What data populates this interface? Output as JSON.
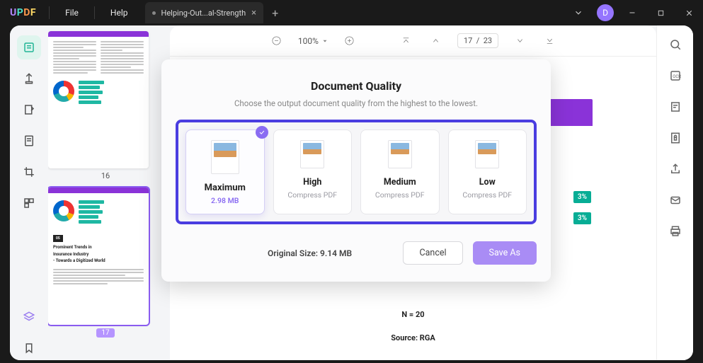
{
  "titlebar": {
    "menus": [
      "File",
      "Help"
    ],
    "tab_title": "Helping-Out...al-Strength",
    "avatar_letter": "D"
  },
  "toolbar": {
    "zoom": "100%",
    "page_current": "17",
    "page_total": "23"
  },
  "thumbnails": [
    {
      "label": "16"
    },
    {
      "label": "17",
      "title1": "Prominent Trends in",
      "title2": "Insurance Industry",
      "title3": "- Towards a Digitized World",
      "badge": "05"
    }
  ],
  "document": {
    "badge1": "3%",
    "badge2": "3%",
    "n_text": "N = 20",
    "source_text": "Source: RGA"
  },
  "modal": {
    "title": "Document Quality",
    "subtitle": "Choose the output document quality from the highest to the lowest.",
    "options": [
      {
        "title": "Maximum",
        "sub": "2.98 MB"
      },
      {
        "title": "High",
        "sub": "Compress PDF"
      },
      {
        "title": "Medium",
        "sub": "Compress PDF"
      },
      {
        "title": "Low",
        "sub": "Compress PDF"
      }
    ],
    "original_size": "Original Size: 9.14 MB",
    "cancel": "Cancel",
    "save": "Save As"
  }
}
